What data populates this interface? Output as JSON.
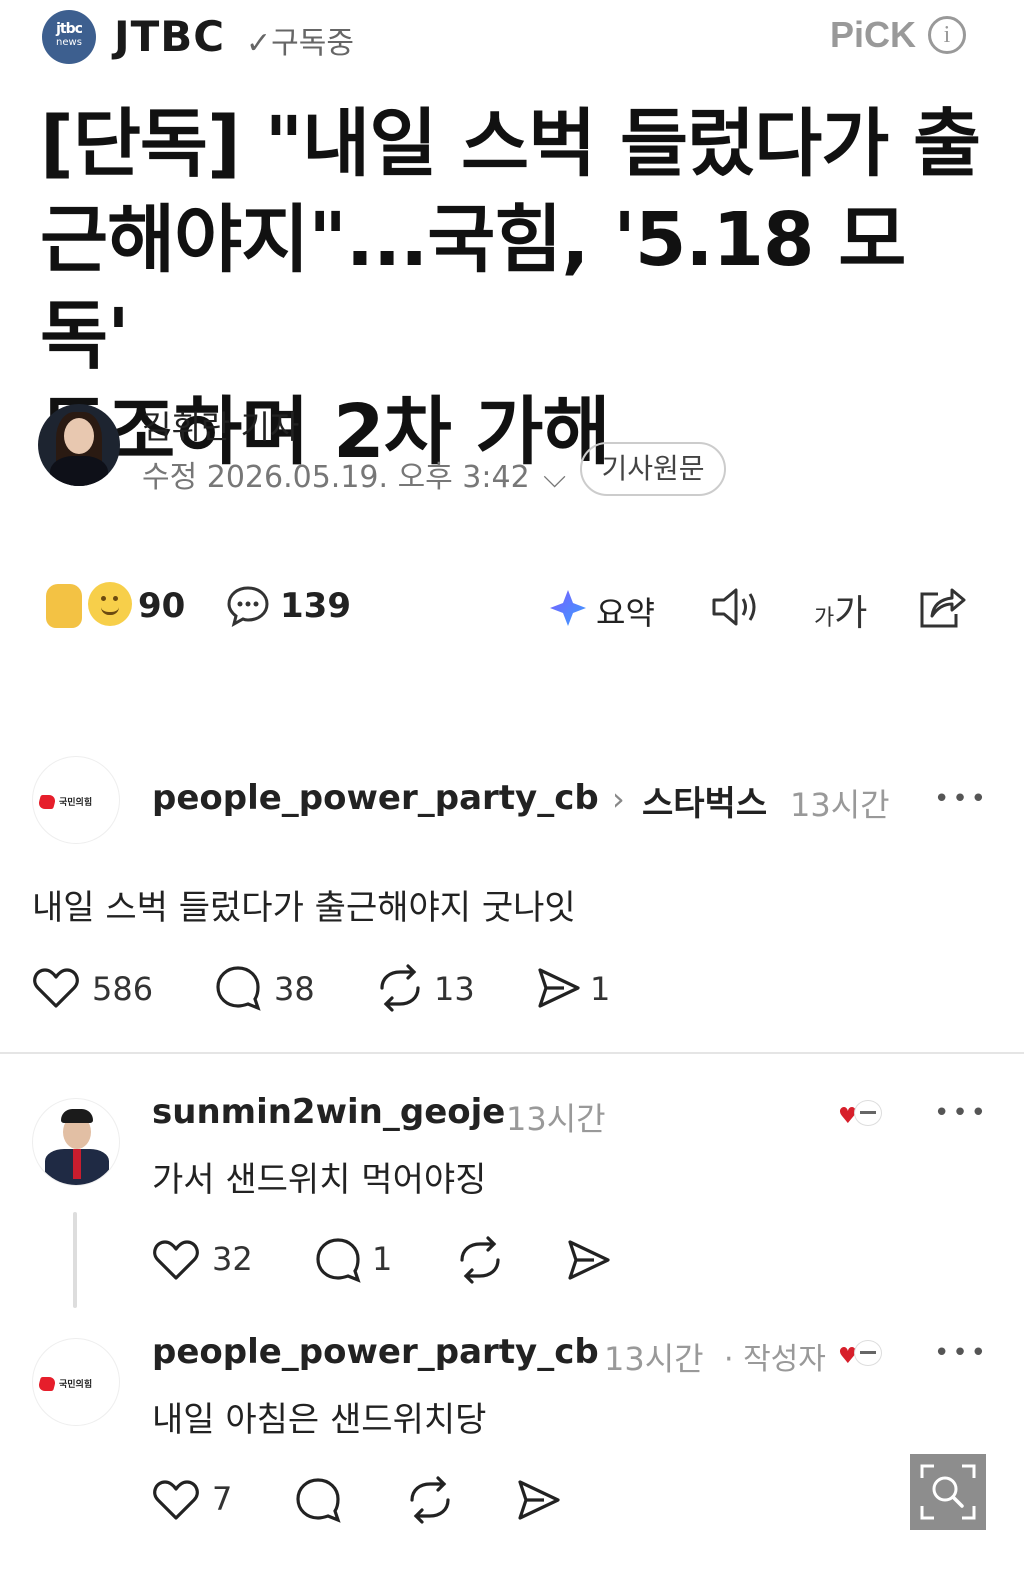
{
  "header": {
    "logo_line1": "jtbc",
    "logo_line2": "news",
    "press_name": "JTBC",
    "subscribe_label": "✓구독중",
    "pick_label": "PiCK",
    "info_icon": "info-circle-icon"
  },
  "article": {
    "headline_line1": "[단독] \"내일 스벅 들렀다가 출",
    "headline_line2": "근해야지\"...국힘, '5.18 모독'",
    "headline_line3": "동조하며 2차 가해",
    "reporter_name": "김휘란 기자",
    "modified": "수정 2026.05.19. 오후 3:42",
    "original_button": "기사원문"
  },
  "actions": {
    "reaction_count": "90",
    "comment_count": "139",
    "summary_label": "요약",
    "font_small": "가",
    "font_large": "가"
  },
  "posts": [
    {
      "username": "people_power_party_cb",
      "location_tag": "스타벅스",
      "time": "13시간",
      "text": "내일 스벅 들렀다가 출근해야지 굿나잇",
      "likes": "586",
      "replies": "38",
      "reposts": "13",
      "shares": "1"
    },
    {
      "username": "sunmin2win_geoje",
      "time": "13시간",
      "text": "가서 샌드위치 먹어야징",
      "likes": "32",
      "replies": "1"
    },
    {
      "username": "people_power_party_cb",
      "time": "13시간",
      "author_tag": "· 작성자",
      "text": "내일 아침은 샌드위치당",
      "likes": "7"
    }
  ],
  "ppp_logo_text": "국민의힘",
  "more_glyph": "•••",
  "chevron_glyph": "›",
  "colors": {
    "party_red": "#e61e2b",
    "muted_gray": "#999999",
    "divider": "#e5e5e5"
  }
}
